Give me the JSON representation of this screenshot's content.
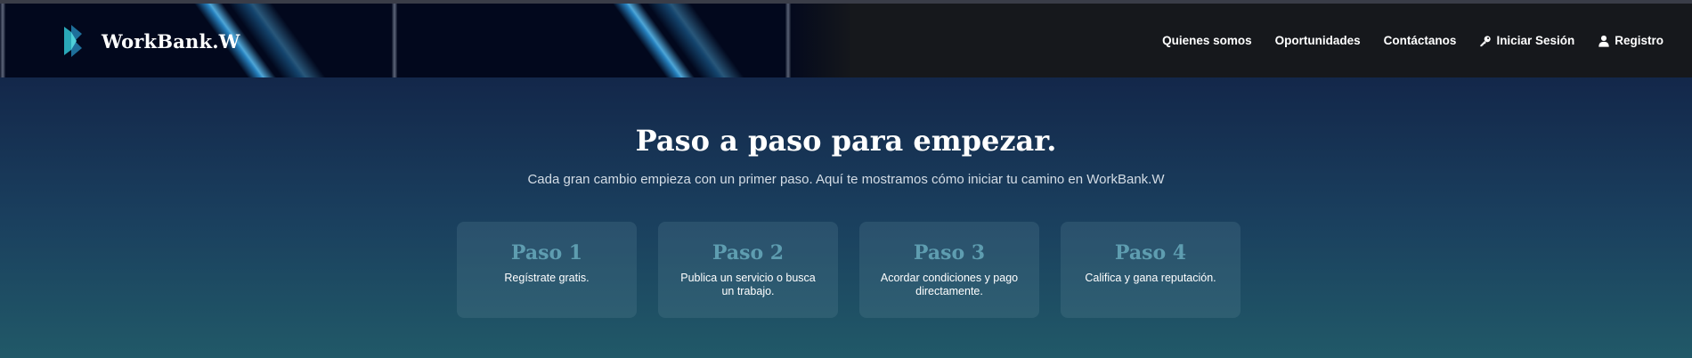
{
  "header": {
    "brand": "WorkBank.W",
    "logo_icon": "workbank-logo-icon",
    "nav": [
      {
        "label": "Quienes somos",
        "icon": ""
      },
      {
        "label": "Oportunidades",
        "icon": ""
      },
      {
        "label": "Contáctanos",
        "icon": ""
      },
      {
        "label": "Iniciar Sesión",
        "icon": "key-icon"
      },
      {
        "label": "Registro",
        "icon": "user-icon"
      }
    ]
  },
  "main": {
    "title": "Paso a paso para empezar.",
    "subtitle": "Cada gran cambio empieza con un primer paso. Aquí te mostramos cómo iniciar tu camino en WorkBank.W",
    "steps": [
      {
        "title": "Paso 1",
        "text": "Regístrate gratis."
      },
      {
        "title": "Paso 2",
        "text": "Publica un servicio o busca un trabajo."
      },
      {
        "title": "Paso 3",
        "text": "Acordar condiciones y pago directamente."
      },
      {
        "title": "Paso 4",
        "text": "Califica y gana reputación."
      }
    ]
  },
  "colors": {
    "accent": "#5e9db0",
    "header_bg": "#16181c",
    "section_top": "#13274a",
    "section_bottom": "#215968"
  }
}
